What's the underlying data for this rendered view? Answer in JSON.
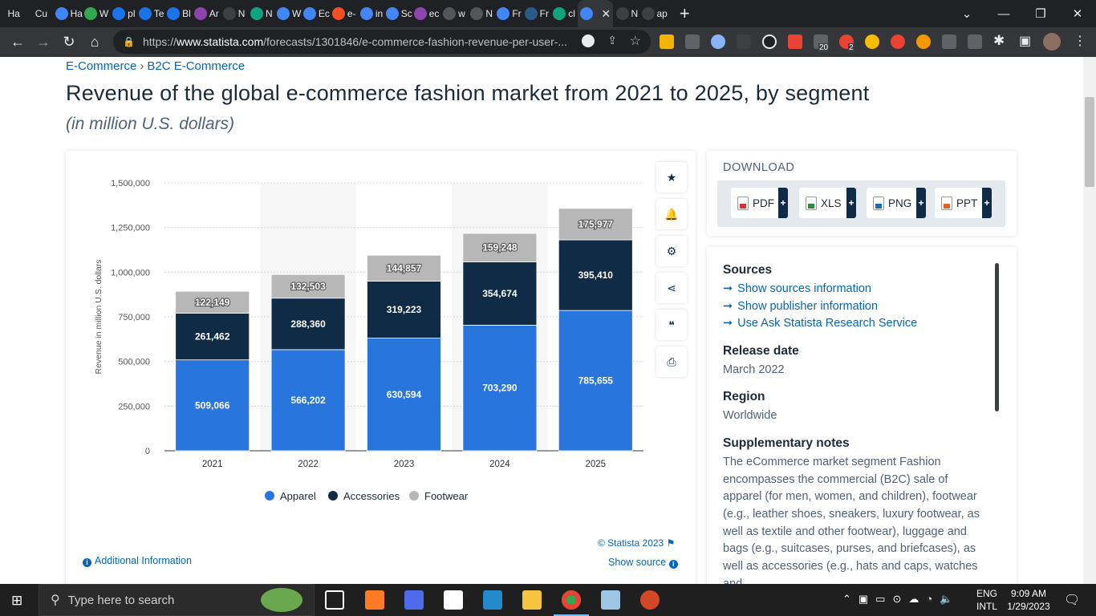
{
  "browser": {
    "tabs": [
      "Ha",
      "Cu",
      "Ha",
      "W",
      "pl",
      "Te",
      "Bl",
      "Ar",
      "N",
      "N",
      "W",
      "Ec",
      "e-",
      "in",
      "Sc",
      "ec",
      "w",
      "N",
      "Fr",
      "Fr",
      "cl",
      "",
      "N",
      "ap"
    ],
    "url_prefix": "https://",
    "url_host": "www.statista.com",
    "url_path": "/forecasts/1301846/e-commerce-fashion-revenue-per-user-...",
    "ext_badges": [
      "20",
      "2"
    ]
  },
  "page": {
    "breadcrumb": [
      "E-Commerce",
      "B2C E-Commerce"
    ],
    "title": "Revenue of the global e-commerce fashion market from 2021 to 2025, by segment",
    "subtitle": "(in million U.S. dollars)",
    "statista_credit": "© Statista 2023",
    "show_source": "Show source",
    "additional_info": "Additional Information"
  },
  "chart_data": {
    "type": "bar",
    "stacked": true,
    "categories": [
      "2021",
      "2022",
      "2023",
      "2024",
      "2025"
    ],
    "series": [
      {
        "name": "Apparel",
        "color": "#2876dd",
        "values": [
          509066,
          566202,
          630594,
          703290,
          785655
        ],
        "labels": [
          "509,066",
          "566,202",
          "630,594",
          "703,290",
          "785,655"
        ]
      },
      {
        "name": "Accessories",
        "color": "#0f2b46",
        "values": [
          261462,
          288360,
          319223,
          354674,
          395410
        ],
        "labels": [
          "261,462",
          "288,360",
          "319,223",
          "354,674",
          "395,410"
        ]
      },
      {
        "name": "Footwear",
        "color": "#b7b7b7",
        "values": [
          122149,
          132503,
          144857,
          159248,
          175977
        ],
        "labels": [
          "122,149",
          "132,503",
          "144,857",
          "159,248",
          "175,977"
        ]
      }
    ],
    "ylabel": "Revenue in million U.S. dollars",
    "ylim": [
      0,
      1500000
    ],
    "yticks": [
      0,
      250000,
      500000,
      750000,
      1000000,
      1250000,
      1500000
    ],
    "ytick_labels": [
      "0",
      "250,000",
      "500,000",
      "750,000",
      "1,000,000",
      "1,250,000",
      "1,500,000"
    ],
    "grid": true,
    "legend": "bottom"
  },
  "download": {
    "title": "DOWNLOAD",
    "buttons": [
      {
        "label": "PDF",
        "color": "#d9342b"
      },
      {
        "label": "XLS",
        "color": "#2b8a3e"
      },
      {
        "label": "PNG",
        "color": "#1c6fb5"
      },
      {
        "label": "PPT",
        "color": "#e0641f"
      }
    ]
  },
  "info": {
    "sources_title": "Sources",
    "links": [
      "Show sources information",
      "Show publisher information",
      "Use Ask Statista Research Service"
    ],
    "release_title": "Release date",
    "release_value": "March 2022",
    "region_title": "Region",
    "region_value": "Worldwide",
    "notes_title": "Supplementary notes",
    "notes_text": "The eCommerce market segment Fashion encompasses the commercial (B2C) sale of apparel (for men, women, and children), footwear (e.g., leather shoes, sneakers, luxury footwear, as well as textile and other footwear), luggage and bags (e.g., suitcases, purses, and briefcases), as well as accessories (e.g., hats and caps, watches and"
  },
  "taskbar": {
    "search_placeholder": "Type here to search",
    "lang_top": "ENG",
    "lang_bottom": "INTL",
    "time": "9:09 AM",
    "date": "1/29/2023"
  },
  "colors": {
    "link": "#0666b3",
    "apparel": "#2876dd",
    "accessories": "#0f2b46",
    "footwear": "#b7b7b7"
  }
}
